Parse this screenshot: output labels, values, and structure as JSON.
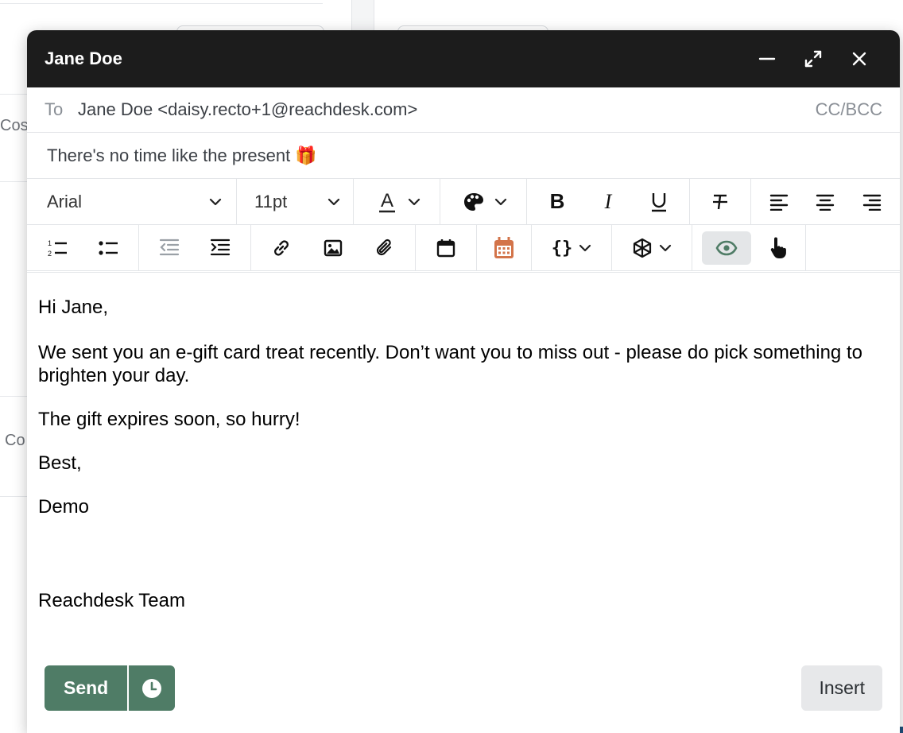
{
  "background": {
    "fragments": [
      "Cos",
      "Co"
    ]
  },
  "composer": {
    "title": "Jane Doe",
    "window_icons": [
      "minimize-icon",
      "expand-icon",
      "close-icon"
    ],
    "to_label": "To",
    "to_value": "Jane Doe <daisy.recto+1@reachdesk.com>",
    "cc_bcc": "CC/BCC",
    "subject": "There's no time like the present 🎁",
    "toolbar": {
      "font_family": "Arial",
      "font_size": "11pt",
      "row1_icons": [
        "font-color-icon",
        "palette-icon",
        "bold-icon",
        "italic-icon",
        "underline-icon",
        "strikethrough-icon",
        "align-left-icon",
        "align-center-icon",
        "align-right-icon"
      ],
      "row2_icons": [
        "numbered-list-icon",
        "bulleted-list-icon",
        "outdent-icon",
        "indent-icon",
        "link-icon",
        "image-icon",
        "attachment-icon",
        "calendar-icon",
        "calendar-grid-icon",
        "curly-braces-icon",
        "cube-icon",
        "eye-icon",
        "pointer-hand-icon"
      ],
      "accent_calendar_color": "#d3744a",
      "active_color": "#4f7c66"
    },
    "body": {
      "greeting": "Hi Jane,",
      "paragraph1": "We sent you an e-gift card treat recently. Don’t want you to miss out - please do pick something to brighten your day.",
      "paragraph2": "The gift expires soon, so hurry!",
      "closing": "Best,",
      "name": "Demo",
      "signature": "Reachdesk Team"
    },
    "footer": {
      "send_label": "Send",
      "insert_label": "Insert",
      "send_color": "#4f7c66"
    }
  }
}
